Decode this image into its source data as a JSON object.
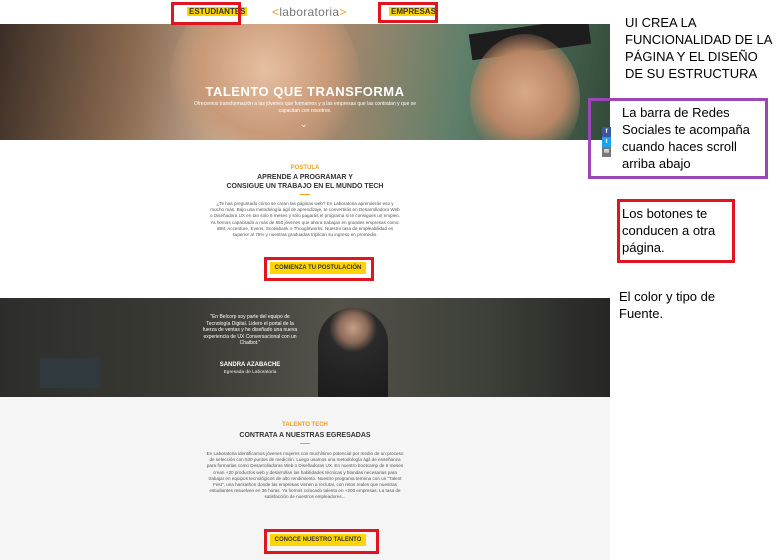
{
  "site": {
    "nav": {
      "students": "ESTUDIANTES",
      "companies": "EMPRESAS"
    },
    "logo": {
      "left": "<",
      "name": "laboratoria",
      "right": ">"
    },
    "hero": {
      "title": "TALENTO QUE TRANSFORMA",
      "subtitle": "Ofrecemos transformación a las jóvenes que formamos y a las empresas que las contratan y que se capacitan con nosotros.",
      "chevron": "⌄"
    },
    "apply_section": {
      "label": "POSTULA",
      "title_line1": "APRENDE A PROGRAMAR Y",
      "title_line2": "CONSIGUE UN TRABAJO EN EL MUNDO TECH",
      "body": "¿Te has preguntado cómo se crean las páginas web? En Laboratoria aprenderás eso y mucho más. Bajo una metodología ágil de aprendizaje, te convertirás en Desarrolladora Web o Diseñadora UX en tan solo 6 meses y sólo pagarás el programa si te consigues un empleo. Ya hemos capacitado a más de 550 jóvenes que ahora trabajan en grandes empresas como: IBM, Accenture, Everis, Scotiabank o Thoughtworks. Nuestra tasa de empleabilidad es superior al 75% y nuestras graduadas triplican su ingreso en promedio.",
      "button": "COMIENZA TU POSTULACIÓN"
    },
    "testimonial": {
      "quote": "\"En Belcorp soy parte del equipo de Tecnología Digital. Lidero el portal de la fuerza de ventas y he diseñado una nueva experiencia de UX Conversacional con un Chatbot.\"",
      "name": "SANDRA AZABACHE",
      "role": "Egresada de Laboratoria"
    },
    "hire_section": {
      "label": "TALENTO TECH",
      "title": "CONTRATA A NUESTRAS EGRESADAS",
      "body": "En Laboratoria identificamos jóvenes mujeres con muchísimo potencial por medio de un proceso de selección con 530 puntos de medición. Luego usamos una metodología ágil de enseñanza para formarlas como Desarrolladoras Web o Diseñadoras UX. En nuestro bootcamp de 6 meses crean +20 productos web y desarrollan las habilidades técnicas y blandas necesarias para trabajar en equipos tecnológicos de alto rendimiento. Nuestro programa termina con un \"Talent Fest\", una hackathon donde las empresas vienen a reclutar, con retos reales que nuestras estudiantes resuelven en 36 horas. Ya hemos colocado talento en +200 empresas. La tasa de satisfacción de nuestros empleadores...",
      "button": "CONOCE NUESTRO TALENTO"
    },
    "social": {
      "facebook": "f",
      "twitter": "t",
      "email": "✉"
    }
  },
  "annotations": {
    "note1": "UI CREA LA FUNCIONALIDAD DE LA PÁGINA Y EL DISEÑO DE SU ESTRUCTURA",
    "note2": "La barra de Redes Sociales te acompaña cuando haces scroll arriba abajo",
    "note3": "Los botones te conducen a otra página.",
    "note4": "El color y tipo de Fuente."
  },
  "colors": {
    "accent_yellow": "#ffd400",
    "label_orange": "#f0a020",
    "annotation_red": "#e0151f",
    "annotation_purple": "#9b47b5"
  }
}
